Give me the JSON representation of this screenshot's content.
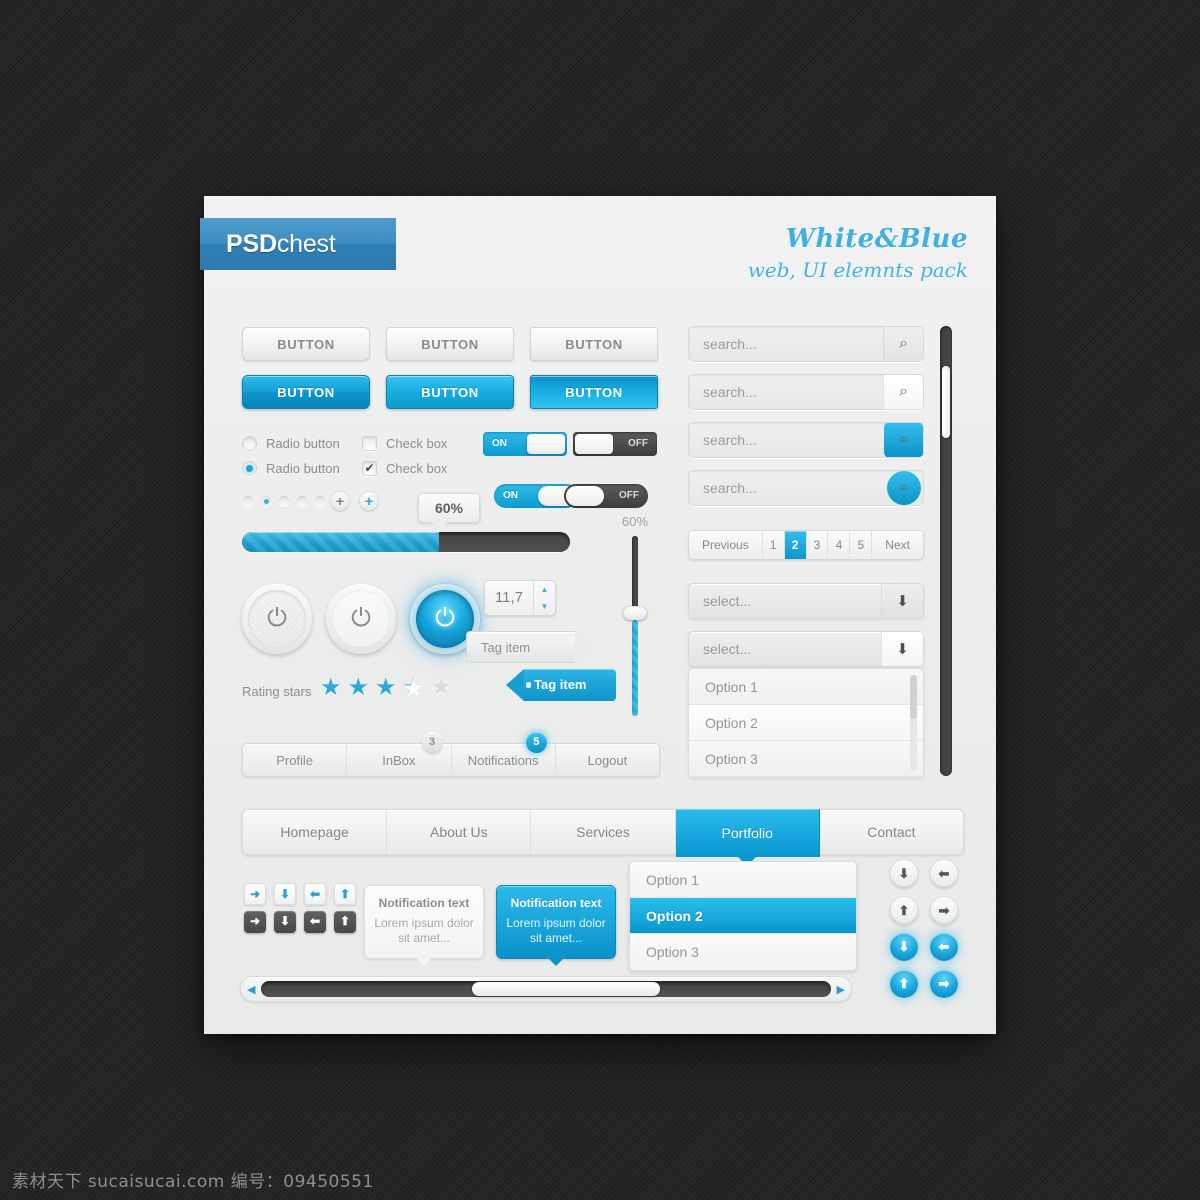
{
  "brand": {
    "ribbon_bold": "PSD",
    "ribbon_light": "chest"
  },
  "headline": {
    "line1": "White&Blue",
    "line2": "web, UI elemnts pack"
  },
  "buttons": {
    "white": [
      {
        "label": "BUTTON"
      },
      {
        "label": "BUTTON"
      },
      {
        "label": "BUTTON"
      }
    ],
    "blue": [
      {
        "label": "BUTTON"
      },
      {
        "label": "BUTTON"
      },
      {
        "label": "BUTTON"
      }
    ]
  },
  "form_controls": {
    "radio_off_label": "Radio button",
    "radio_on_label": "Radio button",
    "checkbox_off_label": "Check box",
    "checkbox_on_label": "Check box",
    "checkbox_check_glyph": "✔",
    "toggles": [
      {
        "state": "ON",
        "label": "ON",
        "shape": "square"
      },
      {
        "state": "OFF",
        "label": "OFF",
        "shape": "square"
      },
      {
        "state": "ON",
        "label": "ON",
        "shape": "round"
      },
      {
        "state": "OFF",
        "label": "OFF",
        "shape": "round"
      }
    ],
    "plus_glyph": "+"
  },
  "progress": {
    "tooltip_value": "60%",
    "percent": 60,
    "side_label": "60%"
  },
  "power_buttons": {
    "glyph": "⏻",
    "states": [
      "inactive",
      "inactive",
      "active"
    ]
  },
  "rating": {
    "label": "Rating stars",
    "value": 3.5,
    "max": 5,
    "star_glyph": "★"
  },
  "stepper": {
    "value": "11,7",
    "up_glyph": "▲",
    "down_glyph": "▼"
  },
  "tags": {
    "gray_label": "Tag item",
    "blue_label": "Tag item"
  },
  "search": {
    "placeholder": "search...",
    "icon": "search-icon",
    "icon_glyph": "⌕",
    "fields": [
      {
        "placeholder": "search...",
        "button": "gray"
      },
      {
        "placeholder": "search...",
        "button": "white"
      },
      {
        "placeholder": "search...",
        "button": "blue"
      },
      {
        "placeholder": "search...",
        "button": "blue"
      }
    ]
  },
  "pagination": {
    "previous_label": "Previous",
    "next_label": "Next",
    "pages": [
      "1",
      "2",
      "3",
      "4",
      "5"
    ],
    "active_page": "2"
  },
  "selects": [
    {
      "value": "select...",
      "arrow_glyph": "⬇"
    },
    {
      "value": "select...",
      "arrow_glyph": "⬇"
    }
  ],
  "option_list": {
    "items": [
      "Option 1",
      "Option 2",
      "Option 3"
    ]
  },
  "account_tabs": {
    "tabs": [
      {
        "label": "Profile",
        "badge": null
      },
      {
        "label": "InBox",
        "badge": "3",
        "badge_style": "gray"
      },
      {
        "label": "Notifications",
        "badge": "5",
        "badge_style": "blue"
      },
      {
        "label": "Logout",
        "badge": null
      }
    ]
  },
  "main_nav": {
    "items": [
      {
        "label": "Homepage",
        "active": false
      },
      {
        "label": "About Us",
        "active": false
      },
      {
        "label": "Services",
        "active": false
      },
      {
        "label": "Portfolio",
        "active": true
      },
      {
        "label": "Contact",
        "active": false
      }
    ]
  },
  "dropdown": {
    "items": [
      {
        "label": "Option 1",
        "selected": false
      },
      {
        "label": "Option 2",
        "selected": true
      },
      {
        "label": "Option 3",
        "selected": false
      }
    ]
  },
  "arrow_buttons": {
    "light": [
      {
        "name": "arrow-right",
        "glyph": "➜"
      },
      {
        "name": "arrow-down",
        "glyph": "⬇"
      },
      {
        "name": "arrow-left",
        "glyph": "⬅"
      },
      {
        "name": "arrow-up",
        "glyph": "⬆"
      }
    ],
    "dark": [
      {
        "name": "arrow-right",
        "glyph": "➜"
      },
      {
        "name": "arrow-down",
        "glyph": "⬇"
      },
      {
        "name": "arrow-left",
        "glyph": "⬅"
      },
      {
        "name": "arrow-up",
        "glyph": "⬆"
      }
    ]
  },
  "notifications": [
    {
      "style": "white",
      "title": "Notification text",
      "body": "Lorem ipsum dolor sit amet..."
    },
    {
      "style": "blue",
      "title": "Notification text",
      "body": "Lorem ipsum dolor sit amet..."
    }
  ],
  "circle_arrows": {
    "white": [
      {
        "name": "arrow-down",
        "glyph": "⬇"
      },
      {
        "name": "arrow-left",
        "glyph": "⬅"
      },
      {
        "name": "arrow-up",
        "glyph": "⬆"
      },
      {
        "name": "arrow-right",
        "glyph": "➡"
      }
    ],
    "blue": [
      {
        "name": "arrow-down",
        "glyph": "⬇"
      },
      {
        "name": "arrow-left",
        "glyph": "⬅"
      },
      {
        "name": "arrow-up",
        "glyph": "⬆"
      },
      {
        "name": "arrow-right",
        "glyph": "➡"
      }
    ]
  },
  "scrollbar": {
    "left_arrow_glyph": "◀",
    "right_arrow_glyph": "▶"
  },
  "watermark": {
    "text": "素材天下  sucaisucai.com   编号：09450551"
  },
  "colors": {
    "accent_blue": "#17a3dc",
    "accent_blue_dark": "#0b8cbd",
    "card_bg": "#ecedee",
    "text_gray": "#8a8d8f",
    "track_dark": "#424446"
  }
}
